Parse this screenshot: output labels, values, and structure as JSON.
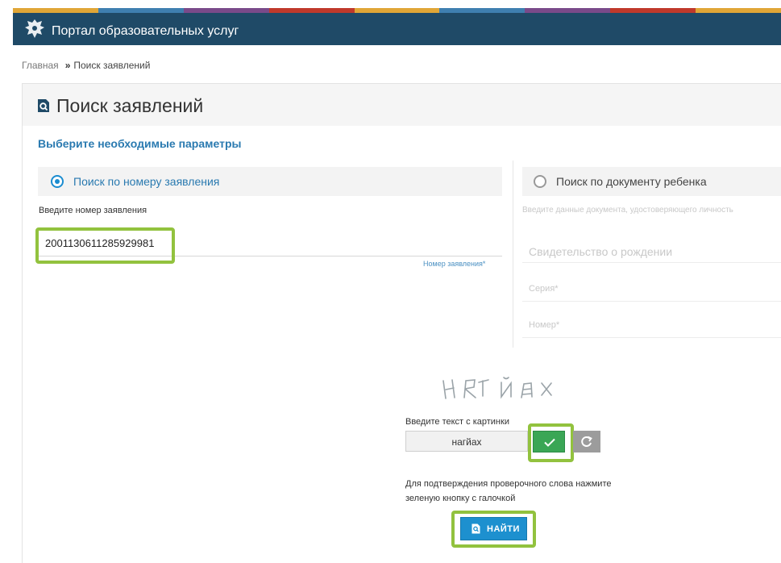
{
  "header": {
    "portal_title": "Портал образовательных услуг",
    "stripe_colors": [
      "#e0a637",
      "#4a90c2",
      "#7a4a8a",
      "#c0392b",
      "#e0a637",
      "#4a90c2",
      "#7a4a8a",
      "#c0392b",
      "#e0a637"
    ]
  },
  "breadcrumb": {
    "home": "Главная",
    "separator": "»",
    "current": "Поиск заявлений"
  },
  "page": {
    "title": "Поиск заявлений",
    "subtitle": "Выберите необходимые параметры"
  },
  "search_by_number": {
    "tab_label": "Поиск по номеру заявления",
    "selected": true,
    "field_label": "Введите номер заявления",
    "value": "2001130611285929981",
    "hint": "Номер заявления*"
  },
  "search_by_document": {
    "tab_label": "Поиск по документу ребенка",
    "selected": false,
    "field_label": "Введите данные документа, удостоверяющего личность",
    "document_type": "Свидетельство о рождении",
    "series_placeholder": "Серия*",
    "number_placeholder": "Номер*"
  },
  "captcha": {
    "image_text": "нагйах",
    "label": "Введите текст с картинки",
    "value": "нагйах"
  },
  "confirm_note": "Для подтверждения проверочного слова нажмите зеленую кнопку с галочкой",
  "find_button": "НАЙТИ",
  "colors": {
    "accent": "#2a7ab0",
    "highlight": "#92c23e",
    "confirm": "#3aa655",
    "header_bg": "#1f4a67"
  }
}
